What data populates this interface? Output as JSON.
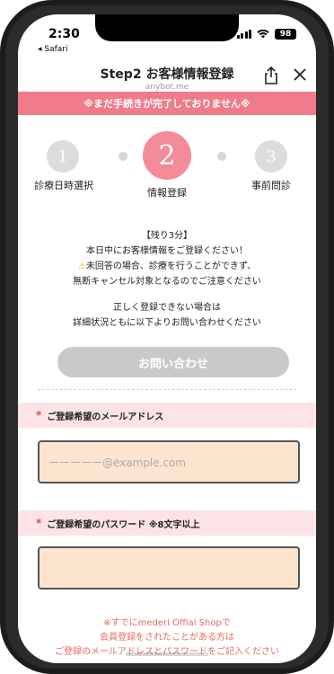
{
  "status_bar": {
    "time": "2:30",
    "back_label": "◂ Safari",
    "battery": "98"
  },
  "nav": {
    "title": "Step2 お客様情報登録",
    "url": "anybot.me"
  },
  "banner": {
    "text": "※まだ手続きが完了しておりません※"
  },
  "steps": [
    {
      "number": "1",
      "label": "診療日時選択",
      "active": false
    },
    {
      "number": "2",
      "label": "情報登録",
      "active": true
    },
    {
      "number": "3",
      "label": "事前問診",
      "active": false
    }
  ],
  "notice": {
    "line1": "【残り3分】",
    "line2": "本日中にお客様情報をご登録ください！",
    "line3": "未回答の場合、診療を行うことができず、",
    "line4": "無断キャンセル対象となるのでご注意ください",
    "line5": "正しく登録できない場合は",
    "line6": "詳細状況ともに以下よりお問い合わせください"
  },
  "inquiry_button": "お問い合わせ",
  "email_section": {
    "required_mark": "*",
    "label": "ご登録希望のメールアドレス",
    "placeholder": "ーーーーー@example.com"
  },
  "password_section": {
    "required_mark": "*",
    "label": "ご登録希望のパスワード ※8文字以上"
  },
  "footer": {
    "line1": "※すでにmederi Offial Shopで",
    "line2": "会員登録をされたことがある方は",
    "line3": "ご登録のメールアドレスとパスワードをご記入ください"
  },
  "colors": {
    "accent_pink": "#f07b8a",
    "field_bg": "#fde4ce",
    "note_red": "#e66a5c"
  }
}
